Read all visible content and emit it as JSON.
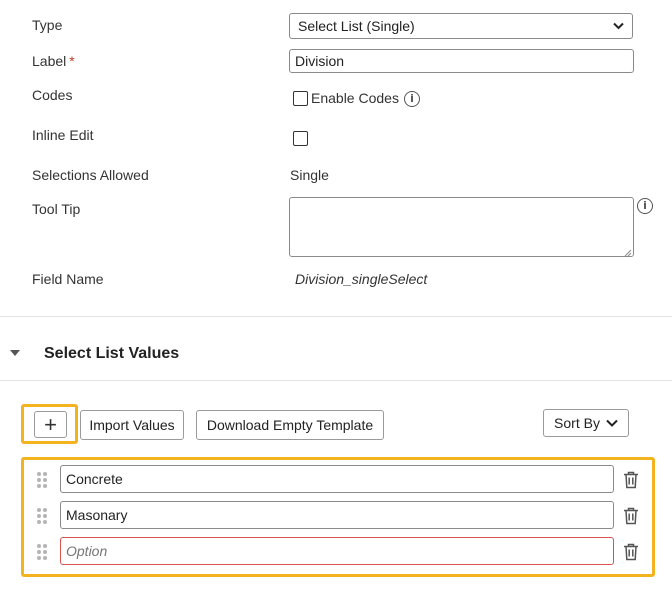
{
  "form": {
    "type_label": "Type",
    "type_value": "Select List (Single)",
    "label_label": "Label",
    "label_required": "*",
    "label_value": "Division",
    "codes_label": "Codes",
    "enable_codes_label": "Enable Codes",
    "enable_codes_checked": false,
    "inline_edit_label": "Inline Edit",
    "inline_edit_checked": false,
    "selections_allowed_label": "Selections Allowed",
    "selections_allowed_value": "Single",
    "tool_tip_label": "Tool Tip",
    "tool_tip_value": "",
    "field_name_label": "Field Name",
    "field_name_value": "Division_singleSelect"
  },
  "select_list_section": {
    "title": "Select List Values",
    "add_button_symbol": "+",
    "import_button": "Import Values",
    "download_button": "Download Empty Template",
    "sort_by_label": "Sort By",
    "options": [
      {
        "value": "Concrete",
        "placeholder": "Option"
      },
      {
        "value": "Masonary",
        "placeholder": "Option"
      },
      {
        "value": "",
        "placeholder": "Option"
      }
    ]
  },
  "colors": {
    "highlight": "#f3b320",
    "required": "#c0392b",
    "error_border": "#d9534f"
  }
}
